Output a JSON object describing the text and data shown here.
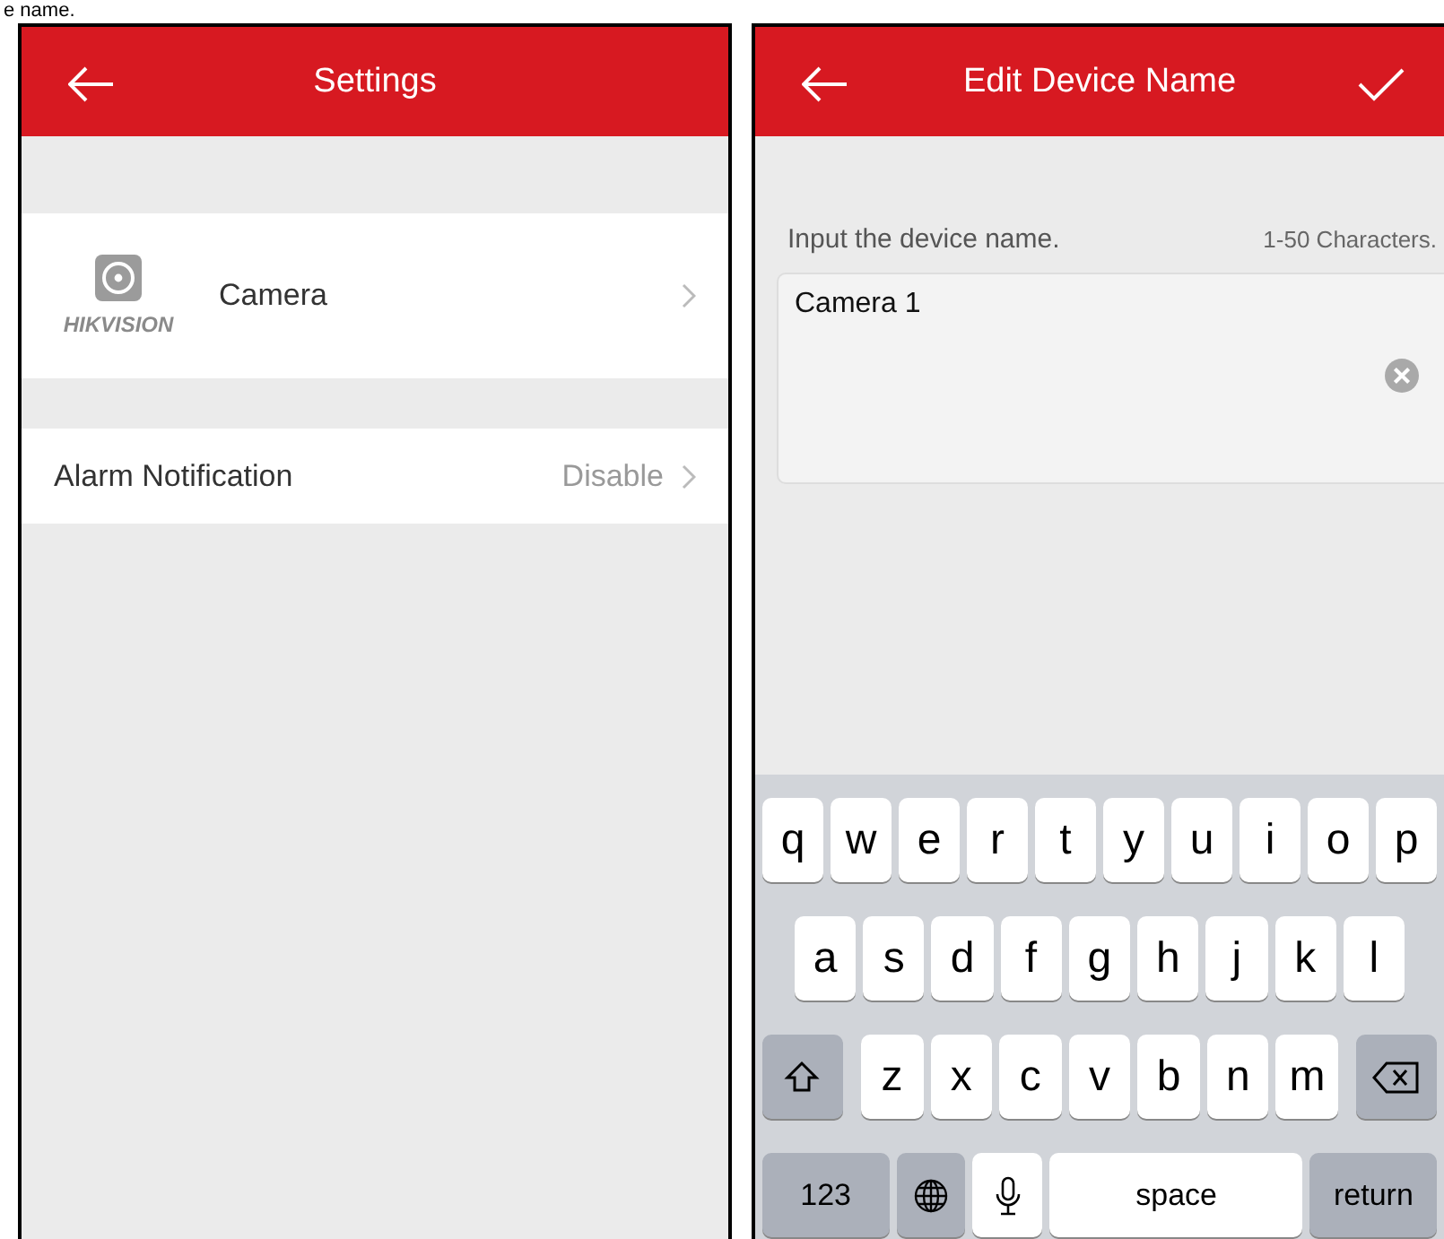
{
  "caption": "e name.",
  "settings_screen": {
    "title": "Settings",
    "items": [
      {
        "kind": "device",
        "label": "Camera",
        "logo_text": "HIKVISION"
      },
      {
        "kind": "value",
        "label": "Alarm Notification",
        "value": "Disable"
      }
    ]
  },
  "edit_screen": {
    "title": "Edit Device Name",
    "prompt": "Input the device name.",
    "limit": "1-50 Characters.",
    "name_field": {
      "value": "Camera 1"
    },
    "keyboard": {
      "rows": [
        {
          "keys": [
            {
              "kind": "letter",
              "label": "q"
            },
            {
              "kind": "letter",
              "label": "w"
            },
            {
              "kind": "letter",
              "label": "e"
            },
            {
              "kind": "letter",
              "label": "r"
            },
            {
              "kind": "letter",
              "label": "t"
            },
            {
              "kind": "letter",
              "label": "y"
            },
            {
              "kind": "letter",
              "label": "u"
            },
            {
              "kind": "letter",
              "label": "i"
            },
            {
              "kind": "letter",
              "label": "o"
            },
            {
              "kind": "letter",
              "label": "p"
            }
          ]
        },
        {
          "keys": [
            {
              "kind": "letter",
              "label": "a"
            },
            {
              "kind": "letter",
              "label": "s"
            },
            {
              "kind": "letter",
              "label": "d"
            },
            {
              "kind": "letter",
              "label": "f"
            },
            {
              "kind": "letter",
              "label": "g"
            },
            {
              "kind": "letter",
              "label": "h"
            },
            {
              "kind": "letter",
              "label": "j"
            },
            {
              "kind": "letter",
              "label": "k"
            },
            {
              "kind": "letter",
              "label": "l"
            }
          ]
        },
        {
          "keys": [
            {
              "kind": "shift"
            },
            {
              "kind": "letter",
              "label": "z"
            },
            {
              "kind": "letter",
              "label": "x"
            },
            {
              "kind": "letter",
              "label": "c"
            },
            {
              "kind": "letter",
              "label": "v"
            },
            {
              "kind": "letter",
              "label": "b"
            },
            {
              "kind": "letter",
              "label": "n"
            },
            {
              "kind": "letter",
              "label": "m"
            },
            {
              "kind": "backspace"
            }
          ]
        },
        {
          "keys": [
            {
              "kind": "function",
              "label": "123"
            },
            {
              "kind": "globe"
            },
            {
              "kind": "mic"
            },
            {
              "kind": "space",
              "label": "space"
            },
            {
              "kind": "function",
              "label": "return"
            }
          ]
        }
      ]
    }
  }
}
